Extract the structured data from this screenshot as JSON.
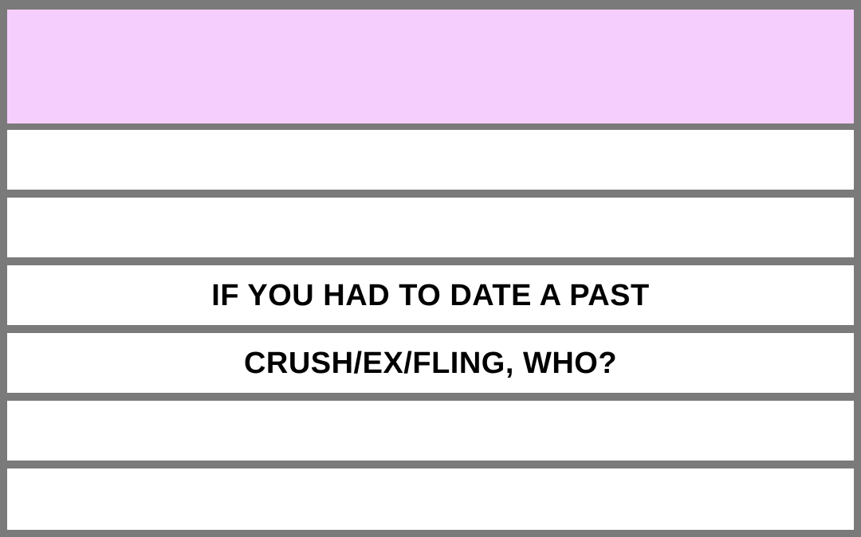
{
  "prompt": {
    "line1": "IF YOU HAD TO DATE A PAST",
    "line2": "CRUSH/EX/FLING, WHO?"
  },
  "colors": {
    "header_fill": "#f5cefe",
    "frame": "#7a7a7a",
    "line_fill": "#ffffff",
    "text": "#000000"
  }
}
